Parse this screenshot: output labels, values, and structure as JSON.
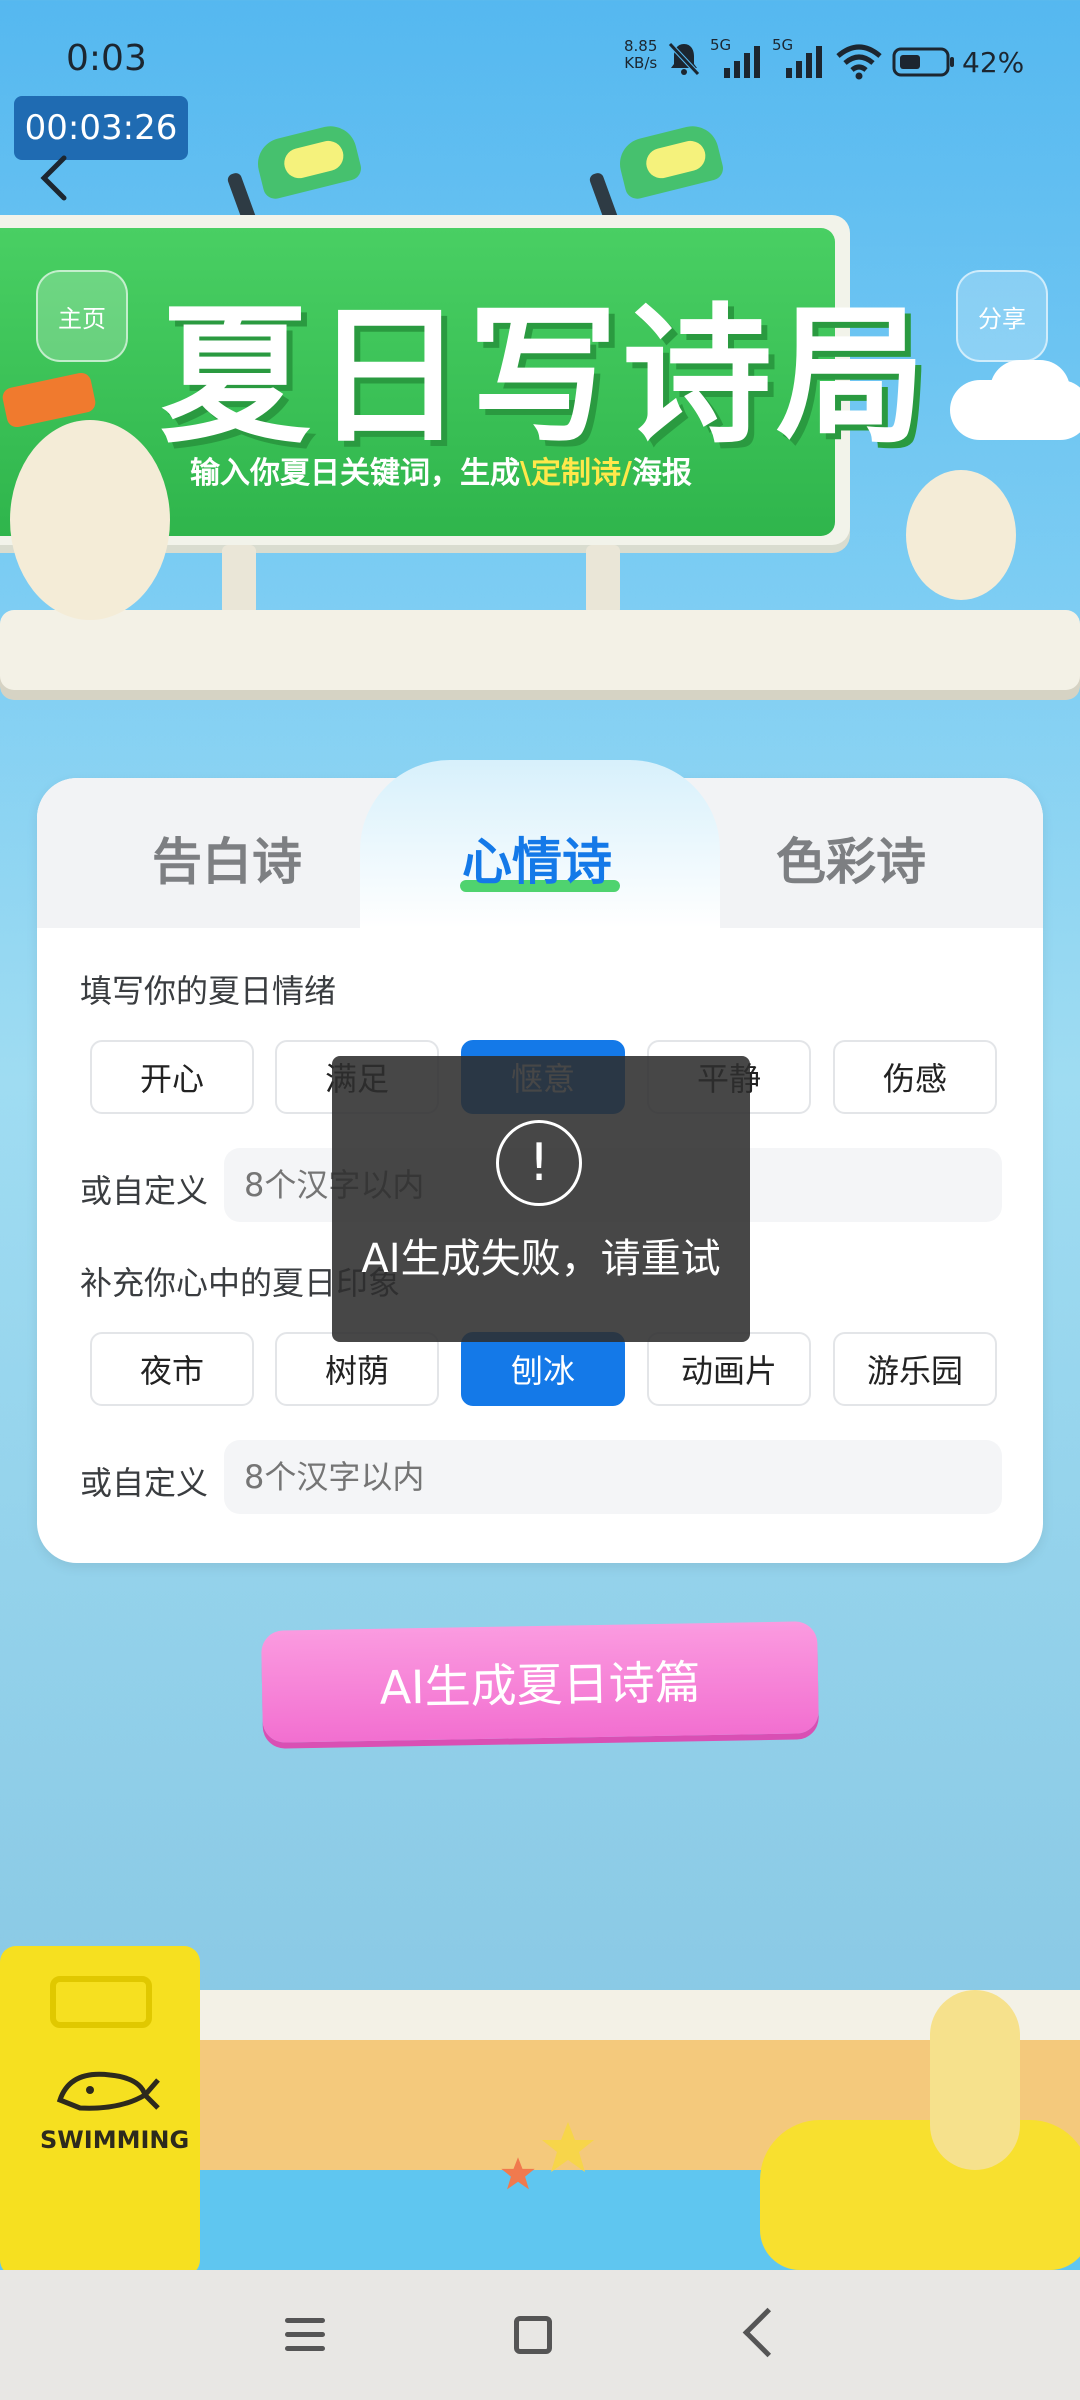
{
  "status_bar": {
    "time": "0:03",
    "net_speed_value": "8.85",
    "net_speed_unit": "KB/s",
    "sim1": "5G",
    "sim2": "5G",
    "battery_percent": "42%"
  },
  "recording_timer": "00:03:26",
  "banner": {
    "title": "夏日写诗局",
    "subtitle_prefix": "输入你夏日关键词，生成",
    "subtitle_highlight": "\\定制诗/",
    "subtitle_suffix": "海报",
    "home_button": "主页",
    "share_button": "分享"
  },
  "tabs": [
    {
      "label": "告白诗",
      "active": false
    },
    {
      "label": "心情诗",
      "active": true
    },
    {
      "label": "色彩诗",
      "active": false
    }
  ],
  "mood_section": {
    "label": "填写你的夏日情绪",
    "chips": [
      "开心",
      "满足",
      "惬意",
      "平静",
      "伤感"
    ],
    "selected": "惬意",
    "custom_label": "或自定义",
    "custom_placeholder": "8个汉字以内"
  },
  "impression_section": {
    "label": "补充你心中的夏日印象",
    "chips": [
      "夜市",
      "树荫",
      "刨冰",
      "动画片",
      "游乐园"
    ],
    "selected": "刨冰",
    "custom_label": "或自定义",
    "custom_placeholder": "8个汉字以内"
  },
  "generate_button": "AI生成夏日诗篇",
  "toast": {
    "icon": "exclamation-icon",
    "message": "AI生成失败，请重试"
  },
  "decor": {
    "sign_text": "SWIMMING"
  }
}
